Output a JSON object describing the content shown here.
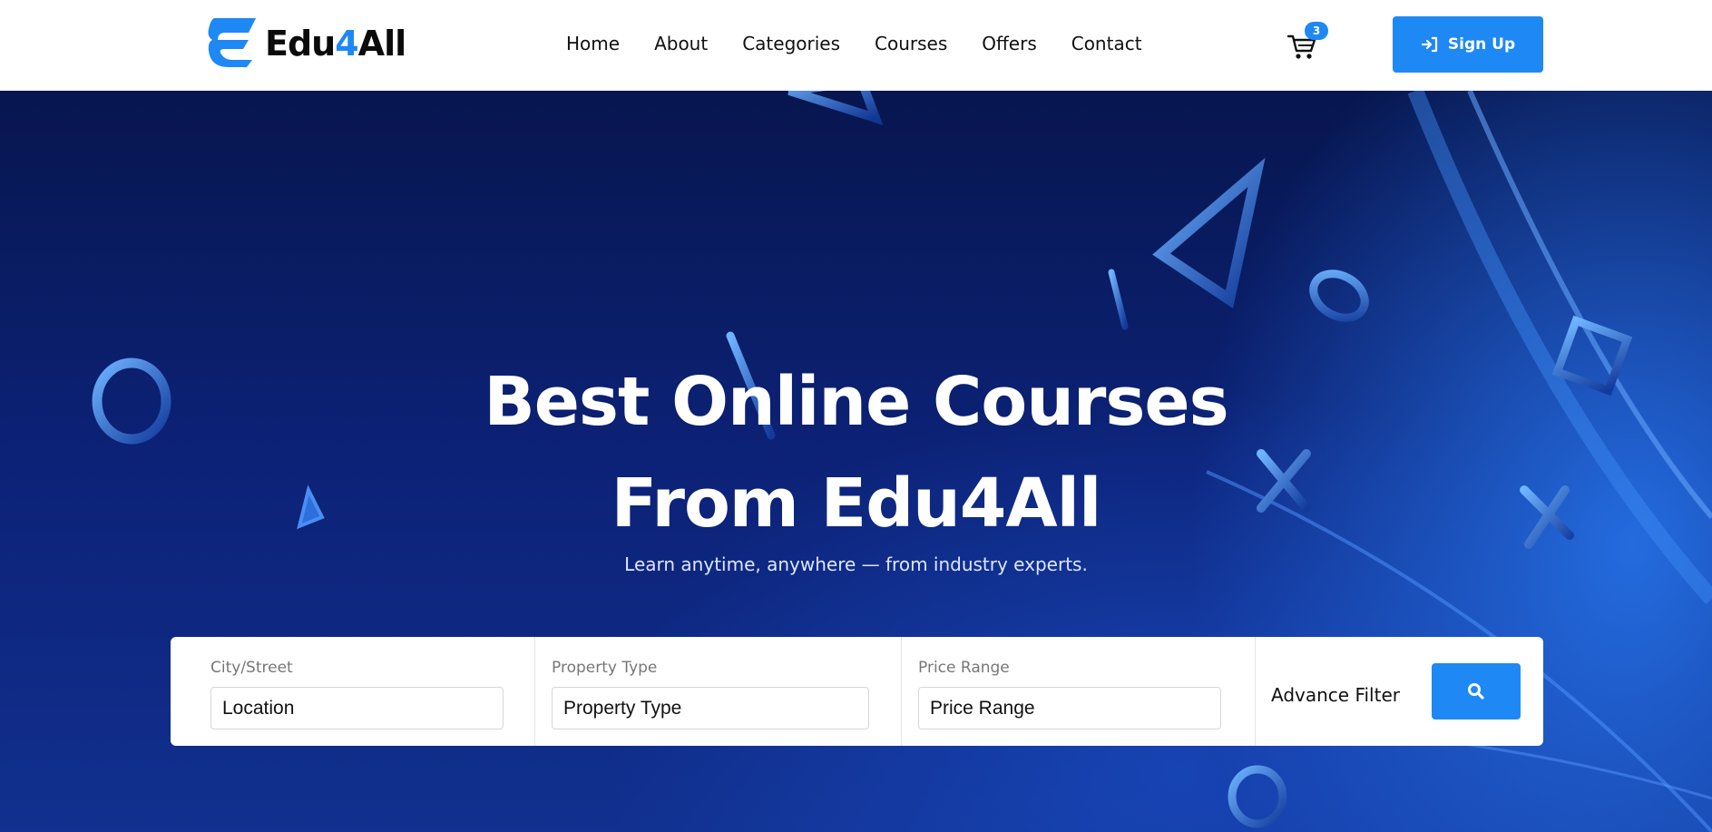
{
  "brand": {
    "name_main": "Edu",
    "name_accent": "4",
    "name_tail": "All",
    "logo_icon": "edu4all-e-logo-icon"
  },
  "nav": {
    "links": [
      {
        "label": "Home"
      },
      {
        "label": "About"
      },
      {
        "label": "Categories"
      },
      {
        "label": "Courses"
      },
      {
        "label": "Offers"
      },
      {
        "label": "Contact"
      }
    ],
    "cart_icon": "shopping-cart-icon",
    "cart_count": "3",
    "signup_icon": "sign-in-icon",
    "signup_label": "Sign Up"
  },
  "hero": {
    "title_line1": "Best Online Courses",
    "title_line2": "From Edu4All",
    "subtitle": "Learn anytime, anywhere — from industry experts.",
    "background_decor": "playstation-shapes"
  },
  "search": {
    "city": {
      "label": "City/Street",
      "placeholder": "Location"
    },
    "property_type": {
      "label": "Property Type",
      "placeholder": "Property Type"
    },
    "price_range": {
      "label": "Price Range",
      "placeholder": "Price Range"
    },
    "advance_filter_label": "Advance Filter",
    "search_icon": "search-icon"
  },
  "colors": {
    "accent": "#1e88f5",
    "navbar_bg": "#ffffff",
    "hero_bg_dark": "#07164f",
    "hero_bg_light": "#2878f0"
  }
}
